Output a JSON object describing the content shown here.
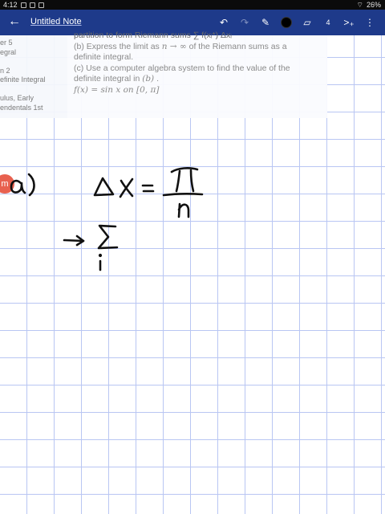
{
  "status_bar": {
    "time": "4:12",
    "battery": "26%"
  },
  "app_bar": {
    "back_icon": "arrow-left-icon",
    "title": "Untitled Note",
    "page_number": "4"
  },
  "sidebar": {
    "lines": [
      "er 5",
      "egral",
      "",
      "n 2",
      "efinite Integral",
      "",
      "ulus, Early",
      "endentals 1st"
    ]
  },
  "problem": {
    "line1": "partition to form Riemann sums ∑ f(xᵢ*) Δxᵢ",
    "line2_a": "(b) Express the limit as ",
    "line2_math": "n → ∞",
    "line2_b": " of the Riemann sums as a",
    "line3": "definite integral.",
    "line4": "(c) Use a computer algebra system to find the value of the",
    "line5_a": "definite integral in ",
    "line5_math": "(b)",
    "line5_b": " .",
    "line6_math": "f(x) = sin x on [0, π]"
  },
  "handwriting": {
    "badge": "m",
    "part_label": "a)"
  },
  "colors": {
    "app_bar": "#1e3a8a",
    "grid": "#b9c6f3",
    "ink": "#111111",
    "badge": "#e8614f"
  }
}
